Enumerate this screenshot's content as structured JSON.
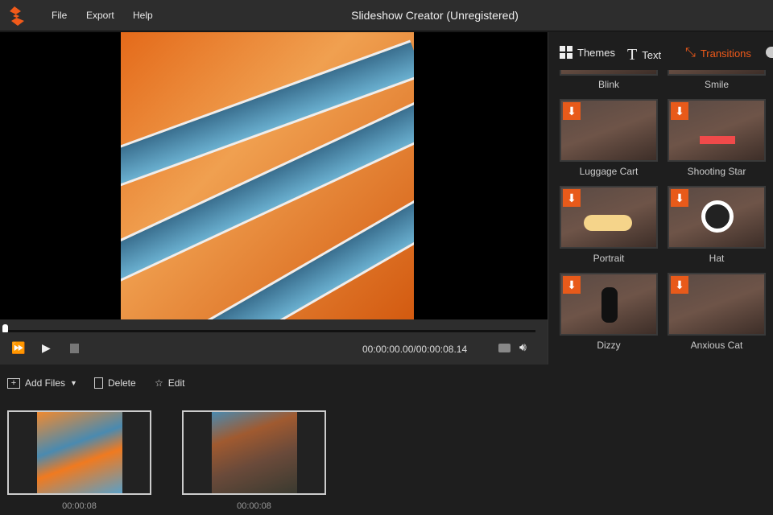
{
  "app": {
    "title": "Slideshow Creator (Unregistered)",
    "menu": [
      "File",
      "Export",
      "Help"
    ]
  },
  "player": {
    "time": "00:00:00.00/00:00:08.14",
    "progress": 0
  },
  "side": {
    "tabs": [
      "Themes",
      "Text",
      "Transitions"
    ],
    "active_tab": "Transitions",
    "partial_items": [
      "Blink",
      "Smile"
    ],
    "items": [
      "Luggage Cart",
      "Shooting Star",
      "Portrait",
      "Hat",
      "Dizzy",
      "Anxious Cat"
    ]
  },
  "toolbar": {
    "add_files": "Add Files",
    "delete": "Delete",
    "edit": "Edit"
  },
  "clips": [
    {
      "duration": "00:00:08"
    },
    {
      "duration": "00:00:08"
    }
  ],
  "colors": {
    "accent": "#e85a1a"
  }
}
